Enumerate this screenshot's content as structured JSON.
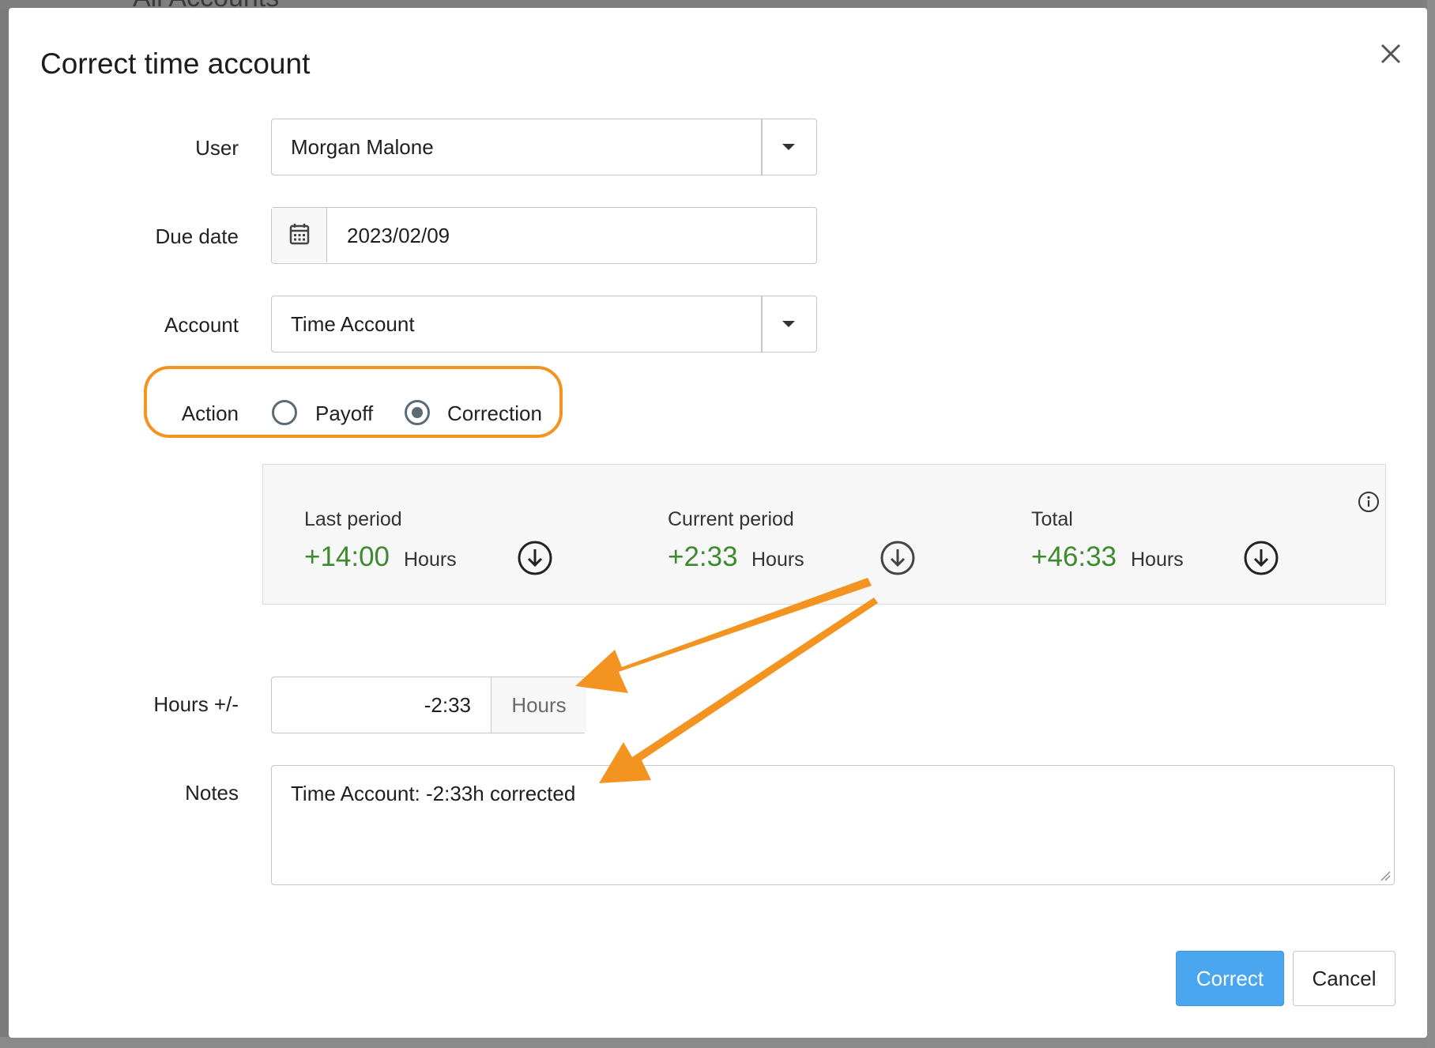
{
  "background": {
    "page_title": "All Accounts"
  },
  "dialog": {
    "title": "Correct time account",
    "close_icon": "close-icon"
  },
  "form": {
    "user": {
      "label": "User",
      "value": "Morgan Malone"
    },
    "due_date": {
      "label": "Due date",
      "value": "2023/02/09",
      "icon": "calendar-icon"
    },
    "account": {
      "label": "Account",
      "value": "Time Account"
    },
    "action": {
      "label": "Action",
      "options": [
        {
          "label": "Payoff",
          "selected": false
        },
        {
          "label": "Correction",
          "selected": true
        }
      ]
    },
    "hours": {
      "label": "Hours +/-",
      "value": "-2:33",
      "unit": "Hours"
    },
    "notes": {
      "label": "Notes",
      "value": "Time Account: -2:33h corrected"
    }
  },
  "summary": {
    "stats": [
      {
        "label": "Last period",
        "value": "+14:00",
        "unit": "Hours"
      },
      {
        "label": "Current period",
        "value": "+2:33",
        "unit": "Hours"
      },
      {
        "label": "Total",
        "value": "+46:33",
        "unit": "Hours"
      }
    ],
    "info_icon": "info-icon"
  },
  "buttons": {
    "correct": "Correct",
    "cancel": "Cancel"
  },
  "colors": {
    "accent": "#f39420",
    "positive": "#3e8a2e",
    "primary": "#4aa6ee"
  }
}
